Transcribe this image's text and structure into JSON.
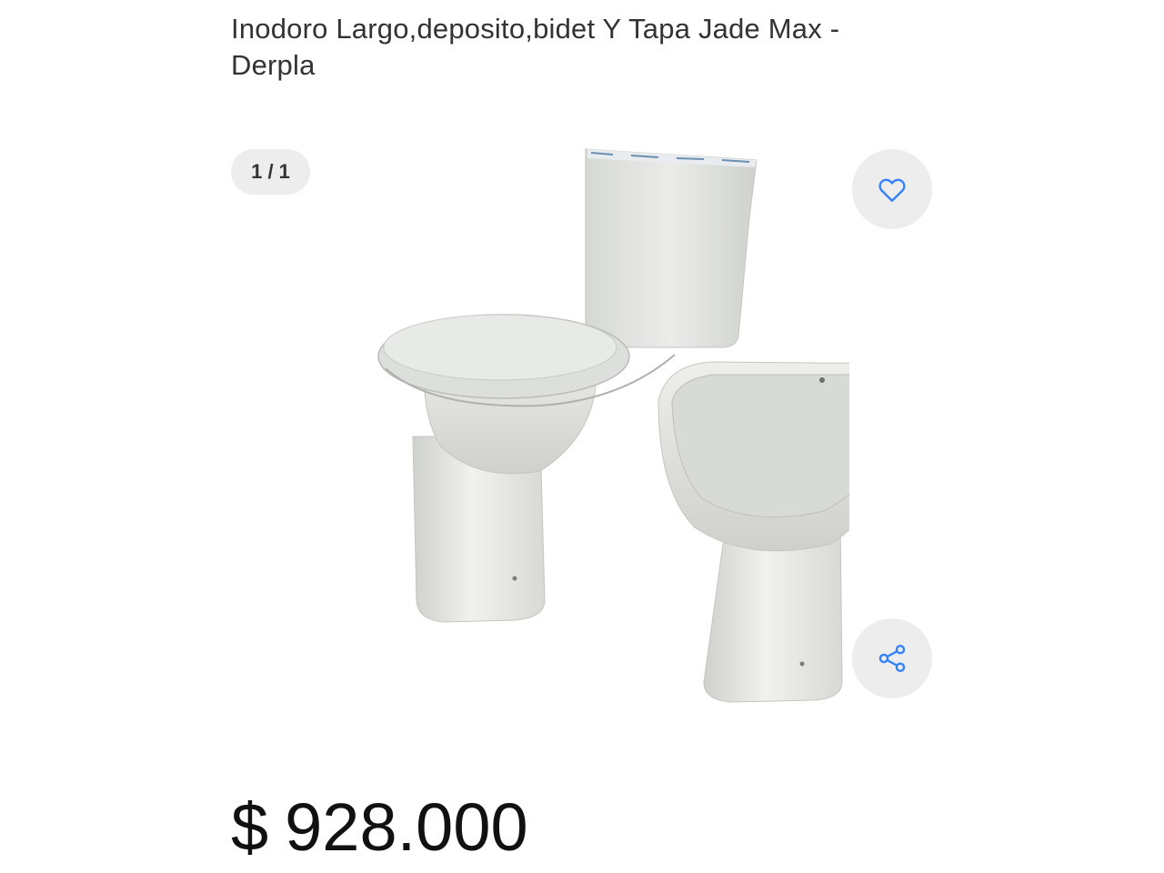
{
  "product": {
    "title": "Inodoro Largo,deposito,bidet Y Tapa Jade Max - Derpla",
    "price_currency": "$",
    "price_amount": "928.000"
  },
  "gallery": {
    "counter": "1 / 1",
    "image_alt": "Inodoro largo con depósito, bidet y tapa Jade Max - Derpla"
  },
  "actions": {
    "favorite_icon": "heart-icon",
    "share_icon": "share-icon"
  },
  "colors": {
    "accent": "#3483fa",
    "button_bg": "#ededed",
    "text": "#333333"
  }
}
